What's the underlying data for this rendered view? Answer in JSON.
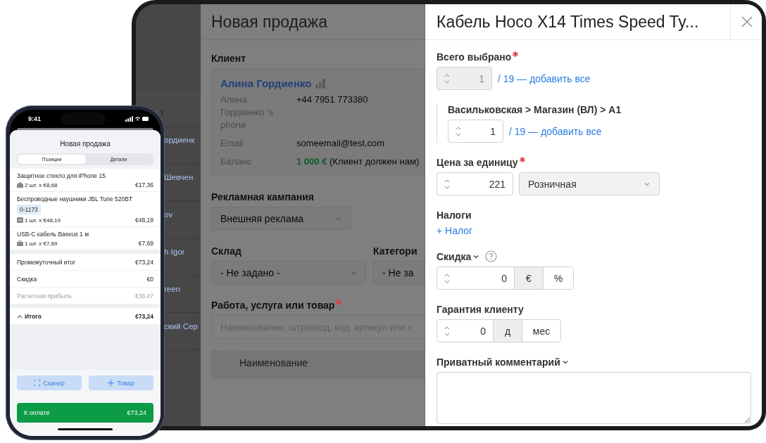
{
  "phone": {
    "status_time": "9:41",
    "title": "Новая продажа",
    "tabs": [
      {
        "label": "Позиции",
        "selected": true
      },
      {
        "label": "Детали",
        "selected": false
      }
    ],
    "items": [
      {
        "kind": "warehouse",
        "name": "Защитное стекло для iPhone 15",
        "qty": "2 шт. x €8,68",
        "total": "€17,36"
      },
      {
        "kind": "serial",
        "name": "Беспроводные наушники JBL Tune 520BT",
        "tag": "0-1173",
        "qty": "1 шт. x €48,19",
        "total": "€48,19"
      },
      {
        "kind": "box",
        "name": "USB-C кабель Baseus 1 м",
        "qty": "1 шт. x €7,69",
        "total": "€7,69"
      }
    ],
    "summary": [
      {
        "label": "Промежуточный итог",
        "value": "€73,24",
        "muted": false
      },
      {
        "label": "Скидка",
        "value": "€0",
        "muted": false
      },
      {
        "label": "Расчетная прибыль",
        "value": "€36,47",
        "muted": true
      }
    ],
    "total": {
      "label": "Итого",
      "value": "€73,24",
      "expanded": true
    },
    "buttons": [
      {
        "kind": "scan",
        "label": "Сканер"
      },
      {
        "kind": "add",
        "label": "Товар"
      }
    ],
    "pay": {
      "label": "К оплате",
      "value": "€73,24"
    }
  },
  "sidebar": {
    "header": "т",
    "rows": [
      "ордиенк",
      "Шевчен",
      "ov",
      "h Igor",
      "reen",
      "ский Сер"
    ]
  },
  "sale_form": {
    "title": "Новая продажа",
    "client": {
      "label": "Клиент",
      "name": "Алина Гордиенко",
      "fields": [
        {
          "label": "Алина Гордиенко 's phone",
          "value": "+44 7951 773380"
        },
        {
          "label": "Email",
          "value": "someemail@test.com"
        },
        {
          "label": "Баланс",
          "value": "**1 000 €** (Клиент должен нам)"
        }
      ]
    },
    "campaign": {
      "label": "Рекламная кампания",
      "value": "Внешняя реклама"
    },
    "warehouse": {
      "label": "Склад",
      "value": "- Не задано -"
    },
    "category": {
      "label": "Категори",
      "value": "- Не за"
    },
    "product": {
      "label": "Работа, услуга или товар",
      "required": true,
      "placeholder": "Наименование, штрихкод, код, артикул или с"
    },
    "table": {
      "columns": [
        "Наименование"
      ]
    }
  },
  "drawer": {
    "title": "Кабель Hoco X14 Times Speed Ty...",
    "total_selected": {
      "label": "Всего выбрано",
      "required": true,
      "value": "1",
      "disabled": true,
      "link": "/ 19 — добавить все"
    },
    "locations": [
      {
        "path": "Васильковская > Магазин (ВЛ) > А1",
        "value": "1",
        "disabled": false,
        "link": "/ 19 — добавить все"
      }
    ],
    "price": {
      "label": "Цена за единицу",
      "required": true,
      "value": "221",
      "price_type": "Розничная"
    },
    "taxes": {
      "label": "Налоги",
      "link": "+ Налог"
    },
    "discount": {
      "label": "Скидка",
      "value": "0",
      "units": [
        {
          "label": "€",
          "selected": true
        },
        {
          "label": "%",
          "selected": false
        }
      ]
    },
    "warranty": {
      "label": "Гарантия клиенту",
      "value": "0",
      "units": [
        {
          "label": "д",
          "selected": true
        },
        {
          "label": "мес",
          "selected": false
        }
      ]
    },
    "comment": {
      "label": "Приватный комментарий"
    }
  }
}
